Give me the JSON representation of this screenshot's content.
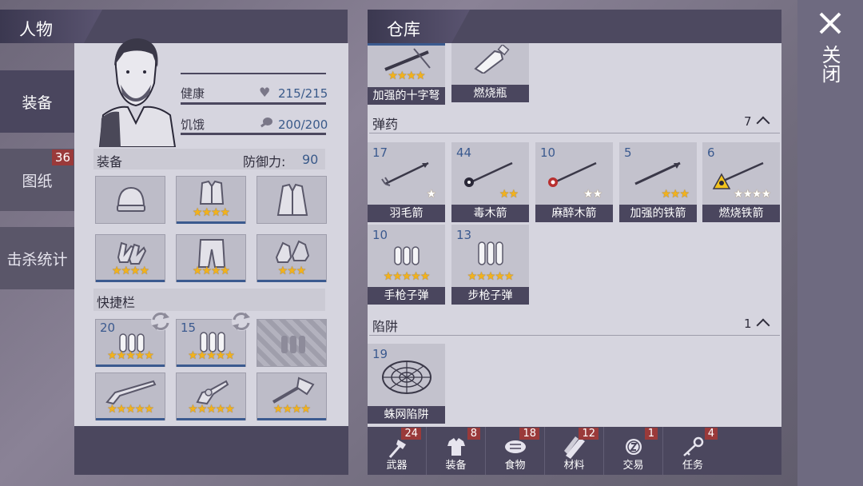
{
  "character": {
    "title": "人物",
    "health_label": "健康",
    "health_value": "215/215",
    "hunger_label": "饥饿",
    "hunger_value": "200/200",
    "equipment_label": "装备",
    "defense_label": "防御力:",
    "defense_value": "90",
    "quickbar_label": "快捷栏"
  },
  "side_tabs": [
    {
      "label": "装备"
    },
    {
      "label": "图纸",
      "badge": "36"
    },
    {
      "label": "击杀统计"
    }
  ],
  "equipment_slots": [
    {
      "name": "helmet",
      "stars": ""
    },
    {
      "name": "body-armor",
      "stars": "★★★★"
    },
    {
      "name": "jacket",
      "stars": ""
    },
    {
      "name": "gloves",
      "stars": "★★★★"
    },
    {
      "name": "pants",
      "stars": "★★★★"
    },
    {
      "name": "shoes",
      "stars": "★★★"
    }
  ],
  "quickbar": [
    {
      "name": "pistol-ammo",
      "count": "20",
      "stars": "★★★★★"
    },
    {
      "name": "rifle-ammo",
      "count": "15",
      "stars": "★★★★★"
    },
    {
      "name": "empty-slot",
      "count": "",
      "stars": ""
    },
    {
      "name": "shotgun",
      "count": "",
      "stars": "★★★★★"
    },
    {
      "name": "revolver",
      "count": "",
      "stars": "★★★★★"
    },
    {
      "name": "axe",
      "count": "",
      "stars": "★★★★"
    }
  ],
  "warehouse": {
    "title": "仓库",
    "top_items": [
      {
        "label": "加强的十字弩",
        "stars": "★★★★"
      },
      {
        "label": "燃烧瓶",
        "stars": ""
      }
    ],
    "ammo": {
      "label": "弹药",
      "count": "7",
      "items": [
        {
          "count": "17",
          "label": "羽毛箭",
          "stars": "★"
        },
        {
          "count": "44",
          "label": "毒木箭",
          "stars": "★★"
        },
        {
          "count": "10",
          "label": "麻醉木箭",
          "stars": "★★"
        },
        {
          "count": "5",
          "label": "加强的铁箭",
          "stars": "★★★"
        },
        {
          "count": "6",
          "label": "燃烧铁箭",
          "stars": "★★★★"
        },
        {
          "count": "10",
          "label": "手枪子弹",
          "stars": "★★★★★"
        },
        {
          "count": "13",
          "label": "步枪子弹",
          "stars": "★★★★★"
        }
      ]
    },
    "traps": {
      "label": "陷阱",
      "count": "1",
      "items": [
        {
          "count": "19",
          "label": "蛛网陷阱",
          "stars": ""
        }
      ]
    }
  },
  "category_tabs": [
    {
      "label": "武器",
      "badge": "24"
    },
    {
      "label": "装备",
      "badge": "8"
    },
    {
      "label": "食物",
      "badge": "18"
    },
    {
      "label": "材料",
      "badge": "12"
    },
    {
      "label": "交易",
      "badge": "1"
    },
    {
      "label": "任务",
      "badge": "4"
    }
  ],
  "close_label": "关闭"
}
